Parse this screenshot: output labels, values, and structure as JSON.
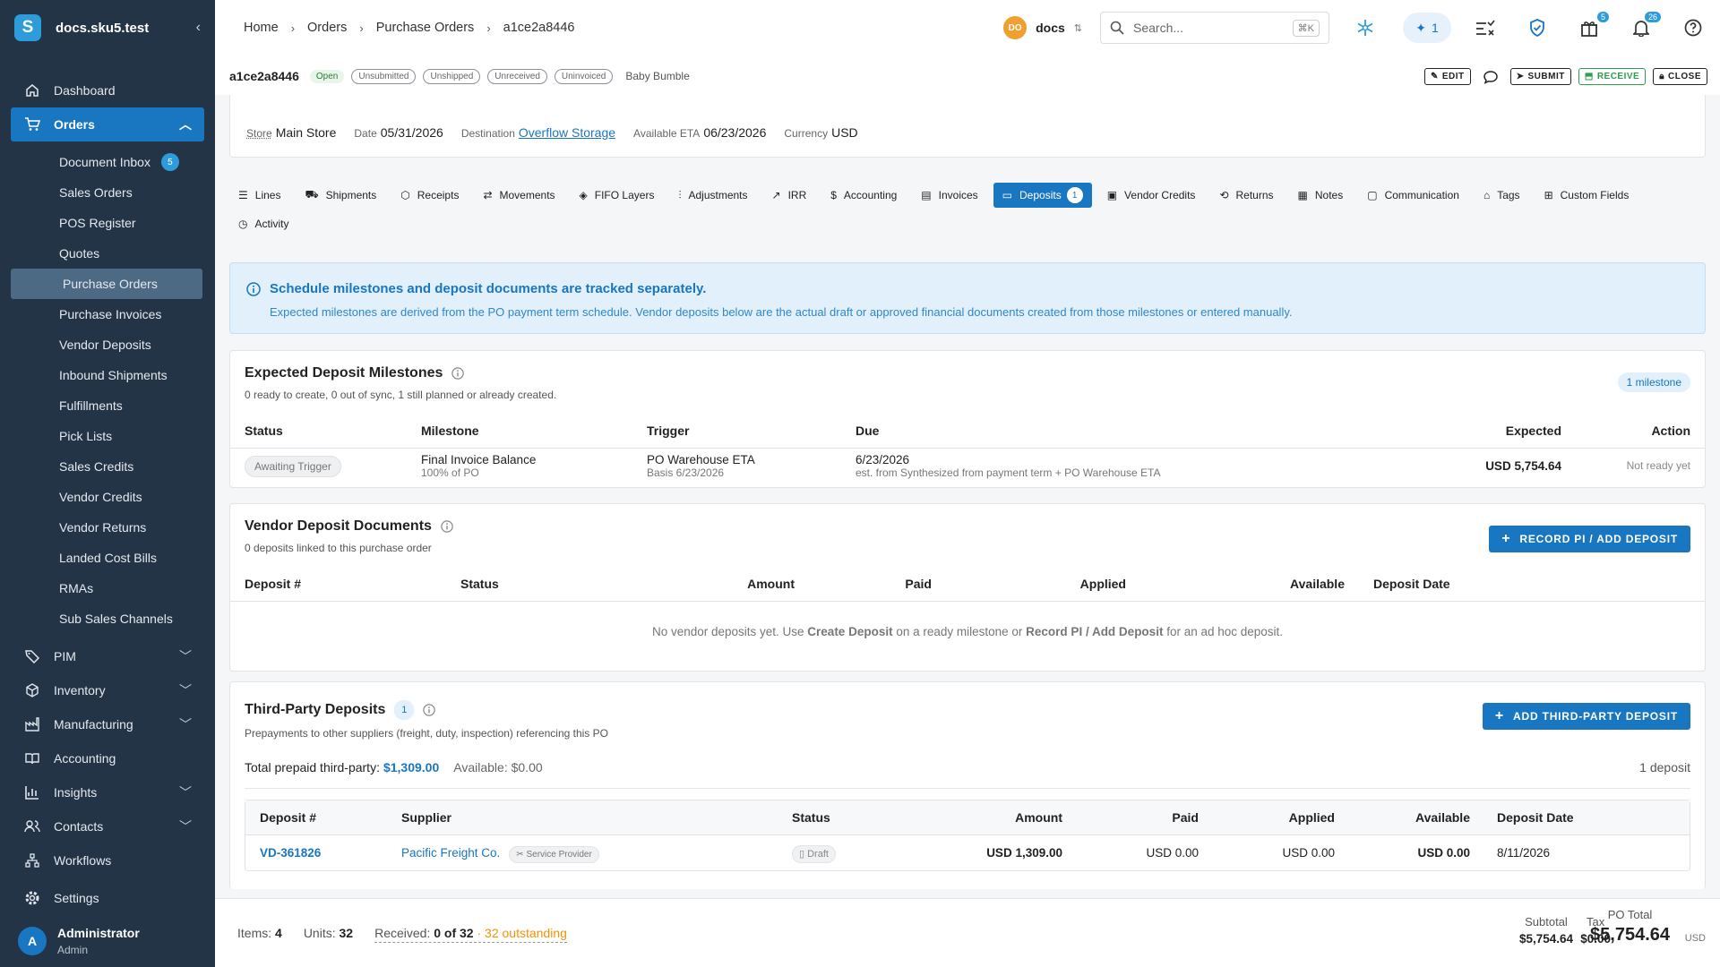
{
  "app": {
    "name": "docs.sku5.test"
  },
  "sidebar": {
    "items": [
      {
        "label": "Dashboard"
      },
      {
        "label": "Orders"
      },
      {
        "label": "PIM"
      },
      {
        "label": "Inventory"
      },
      {
        "label": "Manufacturing"
      },
      {
        "label": "Accounting"
      },
      {
        "label": "Insights"
      },
      {
        "label": "Contacts"
      },
      {
        "label": "Workflows"
      },
      {
        "label": "Settings"
      }
    ],
    "orders_sub": [
      {
        "label": "Document Inbox",
        "badge": "5"
      },
      {
        "label": "Sales Orders"
      },
      {
        "label": "POS Register"
      },
      {
        "label": "Quotes"
      },
      {
        "label": "Purchase Orders"
      },
      {
        "label": "Purchase Invoices"
      },
      {
        "label": "Vendor Deposits"
      },
      {
        "label": "Inbound Shipments"
      },
      {
        "label": "Fulfillments"
      },
      {
        "label": "Pick Lists"
      },
      {
        "label": "Sales Credits"
      },
      {
        "label": "Vendor Credits"
      },
      {
        "label": "Vendor Returns"
      },
      {
        "label": "Landed Cost Bills"
      },
      {
        "label": "RMAs"
      },
      {
        "label": "Sub Sales Channels"
      }
    ],
    "user": {
      "initial": "A",
      "name": "Administrator",
      "role": "Admin"
    }
  },
  "breadcrumb": [
    "Home",
    "Orders",
    "Purchase Orders",
    "a1ce2a8446"
  ],
  "topbar": {
    "org_initials": "DO",
    "org_name": "docs",
    "search_placeholder": "Search...",
    "search_shortcut": "⌘K",
    "ai_count": "1",
    "gift_count": "5",
    "notif_count": "26"
  },
  "po": {
    "id": "a1ce2a8446",
    "status": "Open",
    "chips": [
      "Unsubmitted",
      "Unshipped",
      "Unreceived",
      "Uninvoiced"
    ],
    "supplier": "Baby Bumble",
    "actions": {
      "edit": "EDIT",
      "submit": "SUBMIT",
      "receive": "RECEIVE",
      "close": "CLOSE"
    }
  },
  "order_details": {
    "store_label": "Store",
    "store": "Main Store",
    "date_label": "Date",
    "date": "05/31/2026",
    "dest_label": "Destination",
    "dest": "Overflow Storage",
    "eta_label": "Available ETA",
    "eta": "06/23/2026",
    "currency_label": "Currency",
    "currency": "USD"
  },
  "tabs": [
    {
      "label": "Lines",
      "icon": "list-icon"
    },
    {
      "label": "Shipments",
      "icon": "truck-icon"
    },
    {
      "label": "Receipts",
      "icon": "box-icon"
    },
    {
      "label": "Movements",
      "icon": "arrows-icon"
    },
    {
      "label": "FIFO Layers",
      "icon": "layers-icon"
    },
    {
      "label": "Adjustments",
      "icon": "sliders-icon"
    },
    {
      "label": "IRR",
      "icon": "trend-icon"
    },
    {
      "label": "Accounting",
      "icon": "dollar-icon"
    },
    {
      "label": "Invoices",
      "icon": "document-icon"
    },
    {
      "label": "Deposits",
      "icon": "wallet-icon",
      "count": "1"
    },
    {
      "label": "Vendor Credits",
      "icon": "credit-icon"
    },
    {
      "label": "Returns",
      "icon": "return-icon"
    },
    {
      "label": "Notes",
      "icon": "note-icon"
    },
    {
      "label": "Communication",
      "icon": "chat-icon"
    },
    {
      "label": "Tags",
      "icon": "tag-icon"
    },
    {
      "label": "Custom Fields",
      "icon": "fields-icon"
    },
    {
      "label": "Activity",
      "icon": "history-icon"
    }
  ],
  "info": {
    "title": "Schedule milestones and deposit documents are tracked separately.",
    "desc": "Expected milestones are derived from the PO payment term schedule. Vendor deposits below are the actual draft or approved financial documents created from those milestones or entered manually."
  },
  "milestones": {
    "title": "Expected Deposit Milestones",
    "subtitle": "0 ready to create, 0 out of sync, 1 still planned or already created.",
    "count_badge": "1 milestone",
    "headers": [
      "Status",
      "Milestone",
      "Trigger",
      "Due",
      "Expected",
      "Action"
    ],
    "rows": [
      {
        "status": "Awaiting Trigger",
        "milestone": "Final Invoice Balance",
        "milestone_sub": "100% of PO",
        "trigger": "PO Warehouse ETA",
        "trigger_sub": "Basis 6/23/2026",
        "due": "6/23/2026",
        "due_sub": "est. from Synthesized from payment term + PO Warehouse ETA",
        "expected": "USD 5,754.64",
        "action": "Not ready yet"
      }
    ]
  },
  "vendor_deposits": {
    "title": "Vendor Deposit Documents",
    "subtitle": "0 deposits linked to this purchase order",
    "button": "RECORD PI / ADD DEPOSIT",
    "headers": [
      "Deposit #",
      "Status",
      "Amount",
      "Paid",
      "Applied",
      "Available",
      "Deposit Date"
    ],
    "empty_1": "No vendor deposits yet. Use ",
    "empty_b1": "Create Deposit",
    "empty_2": " on a ready milestone or ",
    "empty_b2": "Record PI / Add Deposit",
    "empty_3": " for an ad hoc deposit."
  },
  "third_party": {
    "title": "Third-Party Deposits",
    "count": "1",
    "subtitle": "Prepayments to other suppliers (freight, duty, inspection) referencing this PO",
    "button": "ADD THIRD-PARTY DEPOSIT",
    "total_label": "Total prepaid third-party:",
    "total": "$1,309.00",
    "available": "Available: $0.00",
    "deposit_count": "1 deposit",
    "headers": [
      "Deposit #",
      "Supplier",
      "Status",
      "Amount",
      "Paid",
      "Applied",
      "Available",
      "Deposit Date"
    ],
    "rows": [
      {
        "id": "VD-361826",
        "supplier": "Pacific Freight Co.",
        "supplier_tag": "Service Provider",
        "status": "Draft",
        "amount": "USD 1,309.00",
        "paid": "USD 0.00",
        "applied": "USD 0.00",
        "available": "USD 0.00",
        "date": "8/11/2026"
      }
    ]
  },
  "footer": {
    "items_label": "Items:",
    "items": "4",
    "units_label": "Units:",
    "units": "32",
    "received_label": "Received:",
    "received": "0 of 32",
    "outstanding": "· 32 outstanding",
    "subtotal_label": "Subtotal",
    "subtotal": "$5,754.64",
    "tax_label": "Tax",
    "tax": "$0.00",
    "total_label": "PO Total",
    "total": "$5,754.64",
    "currency": "USD"
  },
  "colors": {
    "sidebar": "#233446",
    "accent": "#1976c0",
    "warning": "#f39200",
    "success": "#2e9d4e"
  }
}
